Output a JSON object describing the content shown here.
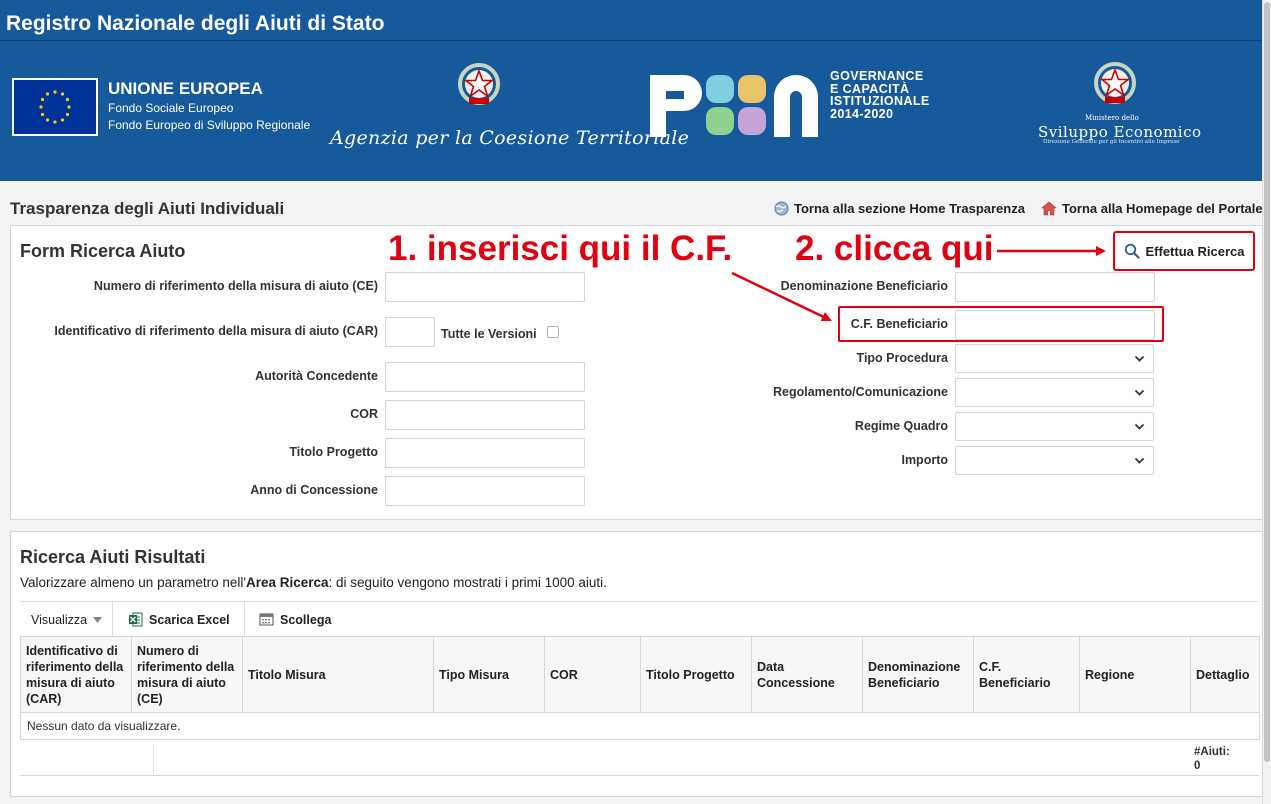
{
  "header": {
    "title": "Registro Nazionale degli Aiuti di Stato"
  },
  "banner": {
    "eu_title": "UNIONE EUROPEA",
    "eu_line1": "Fondo Sociale Europeo",
    "eu_line2": "Fondo Europeo di Sviluppo Regionale",
    "agenzia": "Agenzia per la Coesione Territoriale",
    "pon_line1": "GOVERNANCE",
    "pon_line2": "E CAPACITÀ",
    "pon_line3": "ISTITUZIONALE",
    "pon_line4": "2014-2020",
    "mise_line1": "Ministero dello",
    "mise_line2": "Sviluppo Economico",
    "mise_line3": "Direzione Generale per gli Incentivi alle Imprese"
  },
  "page": {
    "title": "Trasparenza degli Aiuti Individuali",
    "link_home_trasparenza": "Torna alla sezione Home Trasparenza",
    "link_homepage_portale": "Torna alla Homepage del Portale"
  },
  "form": {
    "title": "Form Ricerca Aiuto",
    "search_button": "Effettua Ricerca",
    "labels": {
      "numero_ce": "Numero di riferimento della misura di aiuto (CE)",
      "identificativo_car": "Identificativo di riferimento della misura di aiuto (CAR)",
      "tutte_versioni": "Tutte le Versioni",
      "autorita": "Autorità Concedente",
      "cor": "COR",
      "titolo_progetto": "Titolo Progetto",
      "anno_concessione": "Anno di Concessione",
      "denominazione": "Denominazione Beneficiario",
      "cf_beneficiario": "C.F. Beneficiario",
      "tipo_procedura": "Tipo Procedura",
      "regolamento": "Regolamento/Comunicazione",
      "regime_quadro": "Regime Quadro",
      "importo": "Importo"
    },
    "values": {
      "numero_ce": "",
      "identificativo_car": "",
      "autorita": "",
      "cor": "",
      "titolo_progetto": "",
      "anno_concessione": "",
      "denominazione": "",
      "cf_beneficiario": "",
      "tipo_procedura": "",
      "regolamento": "",
      "regime_quadro": "",
      "importo": ""
    },
    "tutte_versioni_checked": false
  },
  "annotations": {
    "step1": "1. inserisci qui il C.F.",
    "step2": "2. clicca qui",
    "color": "#e1000f"
  },
  "results": {
    "title": "Ricerca Aiuti Risultati",
    "desc_prefix": "Valorizzare almeno un parametro nell'",
    "desc_bold": "Area Ricerca",
    "desc_suffix": ": di seguito vengono mostrati i primi 1000 aiuti.",
    "toolbar": {
      "visualizza": "Visualizza",
      "scarica_excel": "Scarica Excel",
      "scollega": "Scollega"
    },
    "columns": [
      "Identificativo di riferimento della misura di aiuto (CAR)",
      "Numero di riferimento della misura di aiuto (CE)",
      "Titolo Misura",
      "Tipo Misura",
      "COR",
      "Titolo Progetto",
      "Data Concessione",
      "Denominazione Beneficiario",
      "C.F. Beneficiario",
      "Regione",
      "Dettaglio"
    ],
    "empty_message": "Nessun dato da visualizzare.",
    "count_label": "#Aiuti:",
    "count_value": "0"
  },
  "colors": {
    "brand_blue": "#175a9c",
    "highlight_red": "#e1000f",
    "excel_green": "#1d7044"
  }
}
